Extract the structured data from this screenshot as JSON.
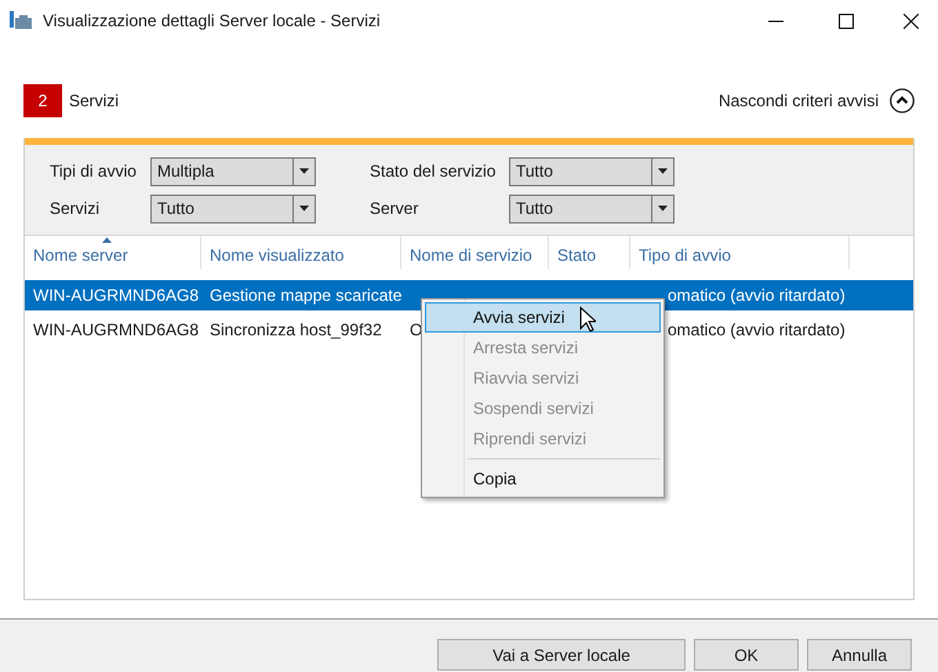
{
  "window": {
    "title": "Visualizzazione dettagli Server locale - Servizi"
  },
  "header": {
    "count": "2",
    "title": "Servizi",
    "toggle_label": "Nascondi criteri avvisi"
  },
  "filters": [
    {
      "label": "Tipi di avvio",
      "value": "Multipla"
    },
    {
      "label": "Stato del servizio",
      "value": "Tutto"
    },
    {
      "label": "Servizi",
      "value": "Tutto"
    },
    {
      "label": "Server",
      "value": "Tutto"
    }
  ],
  "table": {
    "columns": [
      "Nome server",
      "Nome visualizzato",
      "Nome di servizio",
      "Stato",
      "Tipo di avvio"
    ],
    "rows": [
      {
        "selected": true,
        "cells": [
          "WIN-AUGRMND6AG8",
          "Gestione mappe scaricate",
          null,
          null,
          "omatico (avvio ritardato)"
        ]
      },
      {
        "selected": false,
        "cells": [
          "WIN-AUGRMND6AG8",
          "Sincronizza host_99f32",
          "O",
          null,
          "omatico (avvio ritardato)"
        ]
      }
    ]
  },
  "context_menu": {
    "items": [
      {
        "label": "Avvia servizi",
        "disabled": false,
        "selected": true
      },
      {
        "label": "Arresta servizi",
        "disabled": true,
        "selected": false
      },
      {
        "label": "Riavvia servizi",
        "disabled": true,
        "selected": false
      },
      {
        "label": "Sospendi servizi",
        "disabled": true,
        "selected": false
      },
      {
        "label": "Riprendi servizi",
        "disabled": true,
        "selected": false
      },
      {
        "label": "Copia",
        "disabled": false,
        "selected": false,
        "separator_before": true
      }
    ]
  },
  "buttons": [
    "Vai a Server locale",
    "OK",
    "Annulla"
  ]
}
